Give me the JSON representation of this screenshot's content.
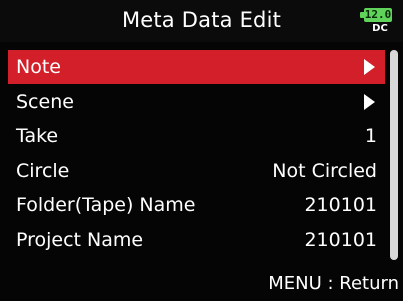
{
  "header": {
    "title": "Meta Data Edit",
    "battery": {
      "value": "12.0",
      "source": "DC",
      "color": "#5fd35a"
    }
  },
  "menu": {
    "items": [
      {
        "label": "Note",
        "value": "",
        "has_submenu": true,
        "selected": true
      },
      {
        "label": "Scene",
        "value": "",
        "has_submenu": true,
        "selected": false
      },
      {
        "label": "Take",
        "value": "1",
        "has_submenu": false,
        "selected": false
      },
      {
        "label": "Circle",
        "value": "Not Circled",
        "has_submenu": false,
        "selected": false
      },
      {
        "label": "Folder(Tape) Name",
        "value": "210101",
        "has_submenu": false,
        "selected": false
      },
      {
        "label": "Project Name",
        "value": "210101",
        "has_submenu": false,
        "selected": false
      }
    ],
    "selected_color": "#d21f2a"
  },
  "footer": {
    "hint": "MENU : Return"
  }
}
